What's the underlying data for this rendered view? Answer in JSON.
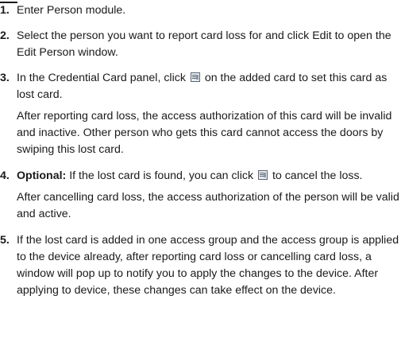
{
  "steps": [
    {
      "number": "1.",
      "text": "Enter Person module."
    },
    {
      "number": "2.",
      "text": "Select the person you want to report card loss for and click Edit to open the Edit Person window."
    },
    {
      "number": "3.",
      "text_before_icon": "In the Credential Card panel, click ",
      "icon": "report-loss-card-icon",
      "text_after_icon": " on the added card to set this card as lost card.",
      "note": "After reporting card loss, the access authorization of this card will be invalid and inactive. Other person who gets this card cannot access the doors by swiping this lost card."
    },
    {
      "number": "4.",
      "label": "Optional:",
      "text_before_icon": " If the lost card is found, you can click ",
      "icon": "cancel-card-loss-icon",
      "text_after_icon": " to cancel the loss.",
      "note": "After cancelling card loss, the access authorization of the person will be valid and active."
    },
    {
      "number": "5.",
      "text": "If the lost card is added in one access group and the access group is applied to the device already, after reporting card loss or cancelling card loss, a window will pop up to notify you to apply the changes to the device. After applying to device, these changes can take effect on the device."
    }
  ]
}
